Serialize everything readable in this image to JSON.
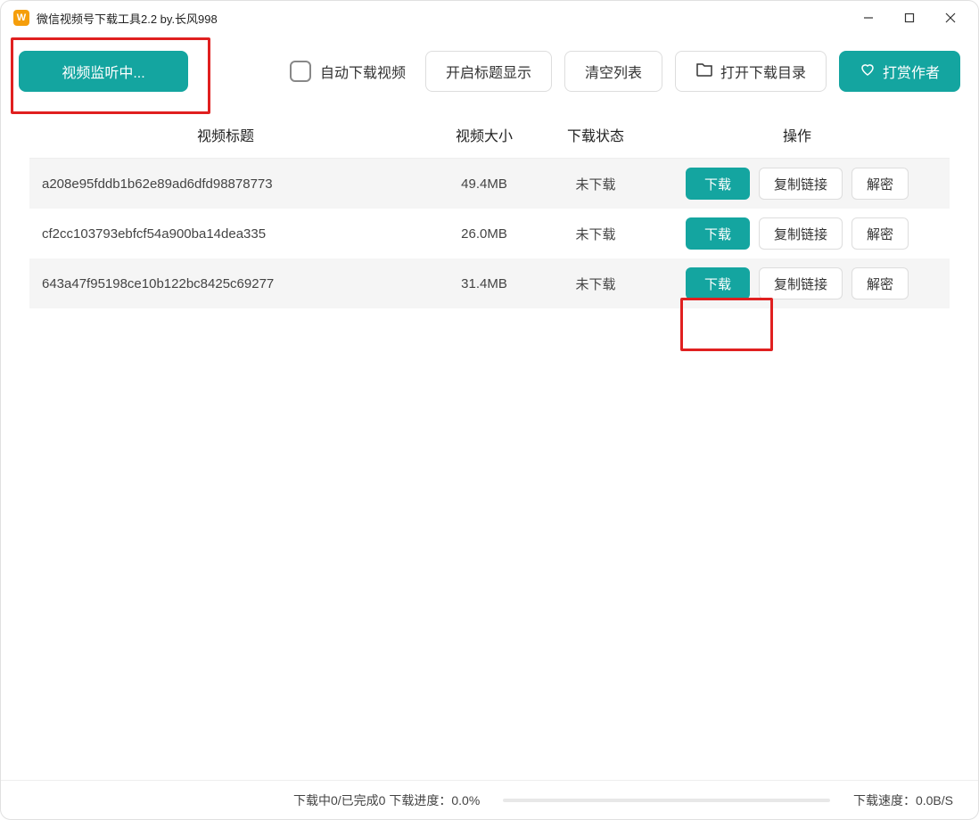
{
  "window": {
    "title": "微信视频号下载工具2.2 by.长风998"
  },
  "toolbar": {
    "monitor": "视频监听中...",
    "autoDownload": "自动下载视频",
    "showTitle": "开启标题显示",
    "clearList": "清空列表",
    "openFolder": "打开下载目录",
    "donate": "打赏作者"
  },
  "columns": {
    "title": "视频标题",
    "size": "视频大小",
    "status": "下载状态",
    "action": "操作"
  },
  "rowButtons": {
    "download": "下载",
    "copyLink": "复制链接",
    "decrypt": "解密"
  },
  "rows": [
    {
      "title": "a208e95fddb1b62e89ad6dfd98878773",
      "size": "49.4MB",
      "status": "未下载"
    },
    {
      "title": "cf2cc103793ebfcf54a900ba14dea335",
      "size": "26.0MB",
      "status": "未下载"
    },
    {
      "title": "643a47f95198ce10b122bc8425c69277",
      "size": "31.4MB",
      "status": "未下载"
    }
  ],
  "status": {
    "progressText": "下载中0/已完成0  下载进度：0.0%",
    "speed": "下载速度：0.0B/S"
  }
}
